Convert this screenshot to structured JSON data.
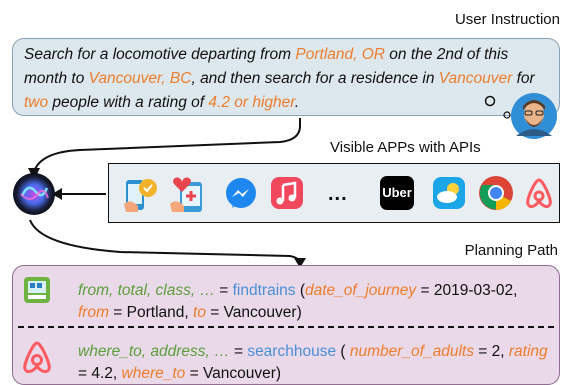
{
  "headings": {
    "user_instruction": "User Instruction",
    "visible_apps": "Visible APPs with APIs",
    "planning_path": "Planning Path"
  },
  "instruction": {
    "p1": "Search for a locomotive departing from ",
    "origin": "Portland, OR",
    "p2": " on the 2nd of this month to ",
    "destination": "Vancouver, BC",
    "p3": ", and then search for a residence in ",
    "city": "Vancouver",
    "p4": " for ",
    "count": "two",
    "p5": " people with a rating of ",
    "rating": "4.2 or higher",
    "p6": "."
  },
  "apps": {
    "ellipsis": "...",
    "icons": [
      "health-app-icon",
      "medical-app-icon",
      "messenger-icon",
      "music-icon",
      "uber-icon",
      "weather-icon",
      "chrome-icon",
      "airbnb-icon"
    ],
    "uber_text": "Uber"
  },
  "plan": {
    "step1": {
      "outputs": "from, total, class, …",
      "eq": " = ",
      "api": "findtrains",
      "open": " (",
      "param1": "date_of_journey",
      "val1": " = 2019-03-02, ",
      "param2": "from",
      "val2": " = Portland, ",
      "param3": "to",
      "val3": " = Vancouver)"
    },
    "step2": {
      "outputs": "where_to, address, …",
      "eq": " = ",
      "api": "searchhouse",
      "open": " ( ",
      "param1": "number_of_adults",
      "val1": " = 2, ",
      "param2": "rating",
      "val2": " = 4.2, ",
      "param3": "where_to",
      "val3": " = Vancouver)"
    }
  },
  "colors": {
    "orange": "#ef7d2b",
    "green": "#5a9f3a",
    "blue": "#4a8fd6",
    "instruction_bg": "#dde7ee",
    "plan_bg": "#ead9e9"
  }
}
